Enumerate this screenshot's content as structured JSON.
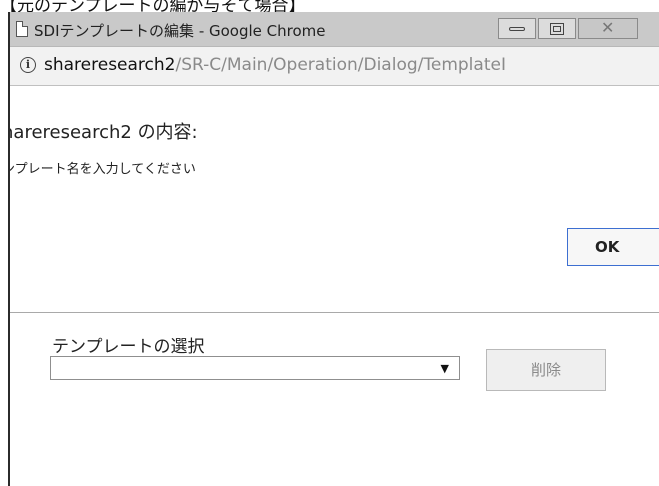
{
  "caption": "【元のテンプレートの編が与そて場合】",
  "window": {
    "title": "SDIテンプレートの編集 - Google Chrome"
  },
  "address": {
    "host": "shareresearch2",
    "path": "/SR-C/Main/Operation/Dialog/TemplateI"
  },
  "dialog": {
    "heading": "hareresearch2 の内容:",
    "message": "ンプレート名を入力してください",
    "ok_label": "OK"
  },
  "form": {
    "select_label": "テンプレートの選択",
    "select_value": "",
    "delete_label": "削除"
  }
}
